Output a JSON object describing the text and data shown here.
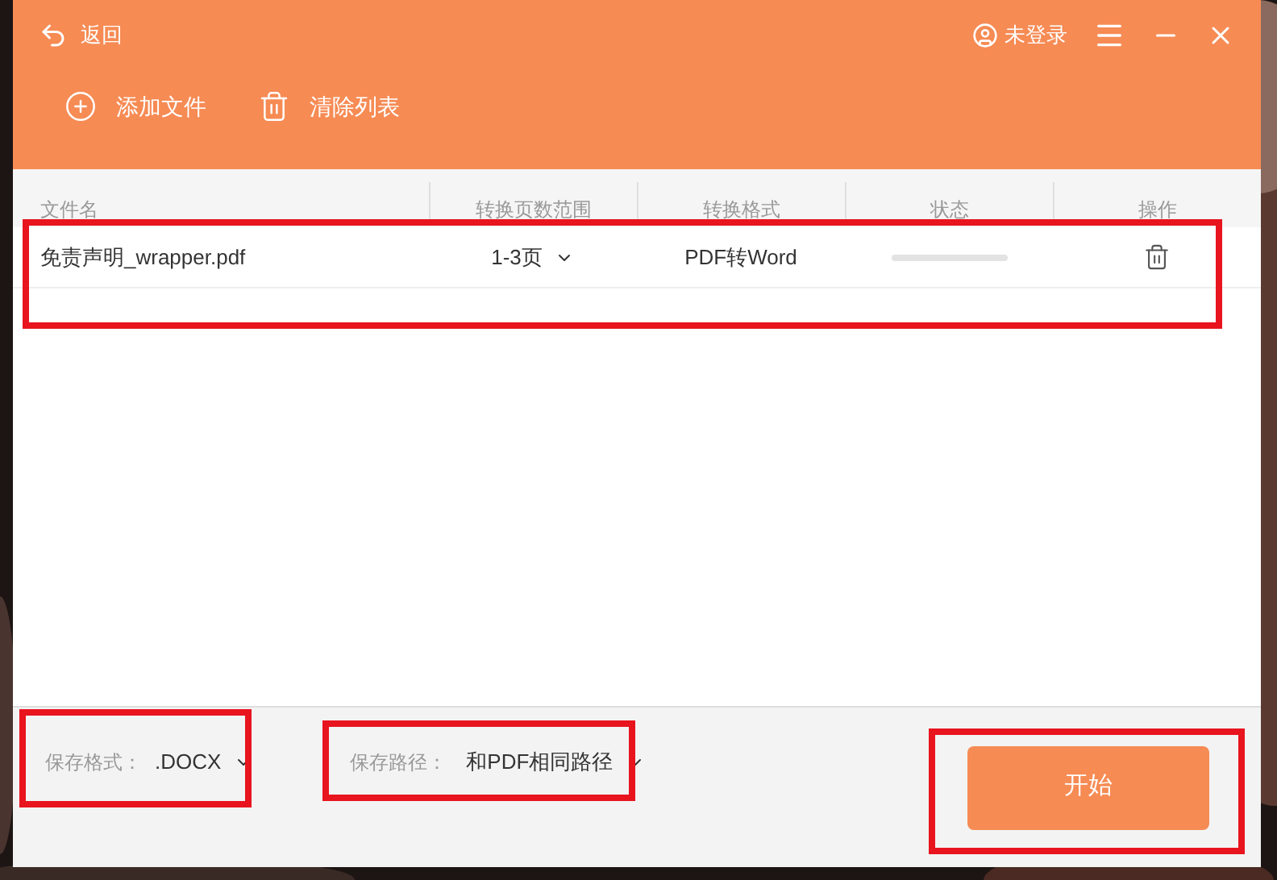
{
  "window": {
    "back": "返回",
    "user": "未登录"
  },
  "toolbar": [
    {
      "kind": "add",
      "label": "添加文件"
    },
    {
      "kind": "clear",
      "label": "清除列表"
    }
  ],
  "table": {
    "columns": [
      "文件名",
      "转换页数范围",
      "转换格式",
      "状态",
      "操作"
    ],
    "rows": [
      {
        "file": "免责声明_wrapper.pdf",
        "pages": "1-3页",
        "format": "PDF转Word"
      }
    ]
  },
  "footer": {
    "format_label": "保存格式：",
    "format_value": ".DOCX",
    "path_label": "保存路径：",
    "path_value": "和PDF相同路径",
    "start": "开始"
  }
}
